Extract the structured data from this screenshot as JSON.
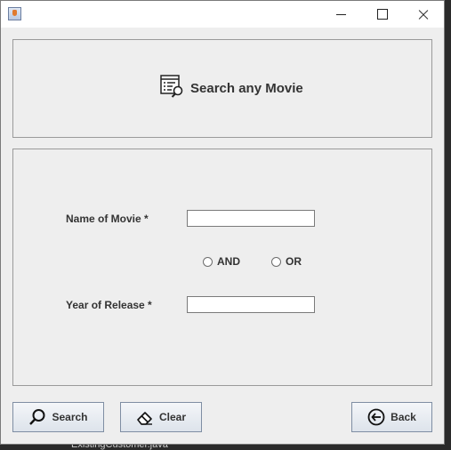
{
  "window": {
    "title": "",
    "controls": {
      "minimize": "minimize-icon",
      "maximize": "maximize-icon",
      "close": "close-icon"
    }
  },
  "header": {
    "title": "Search any Movie",
    "icon": "search-list-icon"
  },
  "form": {
    "movie_name_label": "Name of Movie *",
    "movie_name_value": "",
    "and_label": "AND",
    "or_label": "OR",
    "year_label": "Year of Release *",
    "year_value": ""
  },
  "buttons": {
    "search": {
      "label": "Search",
      "icon": "magnifier-icon"
    },
    "clear": {
      "label": "Clear",
      "icon": "eraser-icon"
    },
    "back": {
      "label": "Back",
      "icon": "back-arrow-icon"
    }
  },
  "background": {
    "partial_text": "ExistingCustomer.java"
  }
}
